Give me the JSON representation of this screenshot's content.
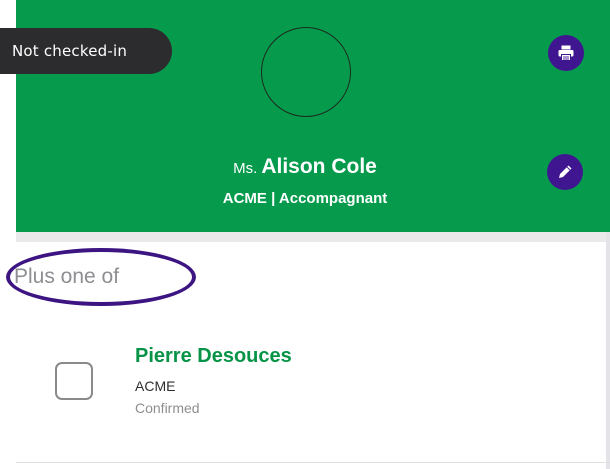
{
  "header": {
    "status_label": "Not checked-in",
    "attendee_title": "Ms.",
    "attendee_name": "Alison Cole",
    "company_role": "ACME | Accompagnant",
    "background_color": "#069b4c",
    "action_color": "#3f168f",
    "print_icon": "printer-icon",
    "edit_icon": "pencil-icon"
  },
  "section": {
    "label": "Plus one of"
  },
  "guest": {
    "name": "Pierre Desouces",
    "company": "ACME",
    "status": "Confirmed",
    "checked": false,
    "name_color": "#079447"
  }
}
